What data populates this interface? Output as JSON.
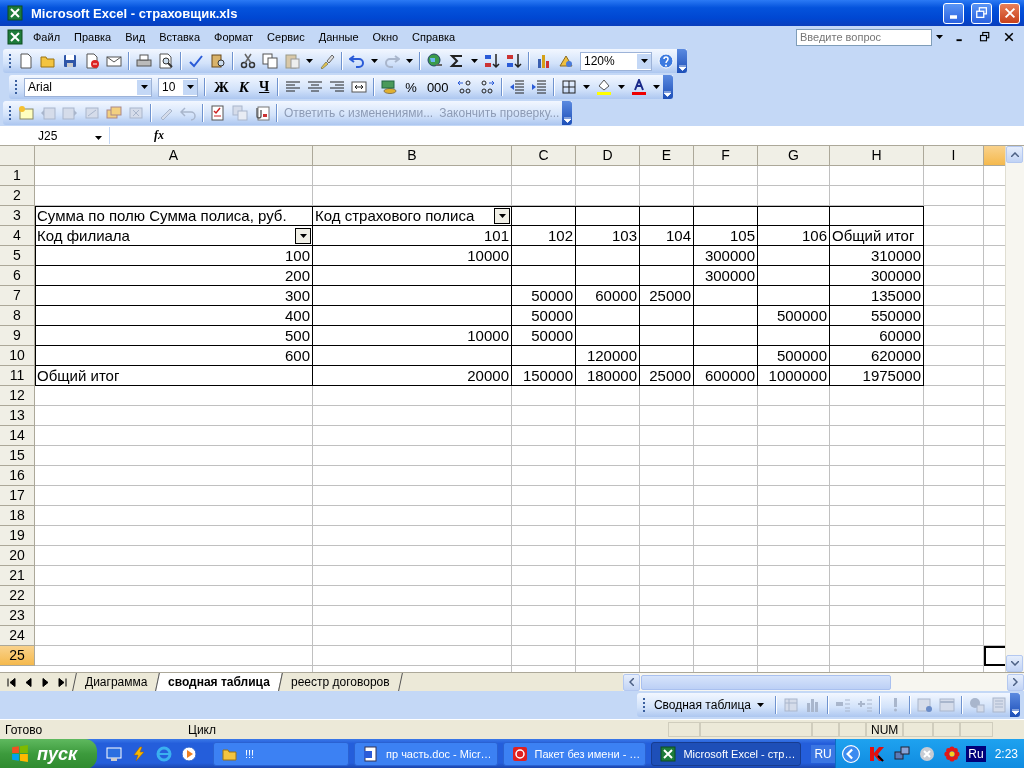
{
  "window": {
    "title": "Microsoft Excel - страховщик.xls"
  },
  "menu_bar": {
    "items": [
      "Файл",
      "Правка",
      "Вид",
      "Вставка",
      "Формат",
      "Сервис",
      "Данные",
      "Окно",
      "Справка"
    ],
    "help_search": {
      "placeholder": "Введите вопрос"
    }
  },
  "standard_toolbar": {
    "zoom": "120%"
  },
  "formatting_toolbar": {
    "font": "Arial",
    "size": "10",
    "bold": "Ж",
    "italic": "К",
    "underline": "Ч",
    "percent": "%",
    "thousands": "000"
  },
  "reviewing_toolbar": {
    "items": [
      {
        "label": "Ответить с изменениями...",
        "disabled": true
      },
      {
        "label": "Закончить проверку...",
        "disabled": true
      }
    ]
  },
  "formula_bar": {
    "name_box": "J25",
    "function_label": "fx"
  },
  "grid": {
    "columns": [
      {
        "label": "A",
        "selected": false
      },
      {
        "label": "B",
        "selected": false
      },
      {
        "label": "C",
        "selected": false
      },
      {
        "label": "D",
        "selected": false
      },
      {
        "label": "E",
        "selected": false
      },
      {
        "label": "F",
        "selected": false
      },
      {
        "label": "G",
        "selected": false
      },
      {
        "label": "H",
        "selected": false
      },
      {
        "label": "I",
        "selected": false
      },
      {
        "selected": true
      }
    ],
    "rows": [
      {
        "number": "1",
        "selected": false,
        "bordered": false
      },
      {
        "number": "2",
        "selected": false,
        "bordered": false
      },
      {
        "number": "3",
        "selected": false,
        "bordered": true,
        "cells": [
          {
            "kind": "text",
            "text": "Сумма по полю Сумма полиса, руб.",
            "dropdown": false
          },
          {
            "kind": "text",
            "text": "Код страхового полиса",
            "dropdown": true
          }
        ]
      },
      {
        "number": "4",
        "selected": false,
        "bordered": true,
        "cells": [
          {
            "kind": "text",
            "text": "Код филиала",
            "dropdown": true
          },
          {
            "kind": "number",
            "text": "101"
          },
          {
            "kind": "number",
            "text": "102"
          },
          {
            "kind": "number",
            "text": "103"
          },
          {
            "kind": "number",
            "text": "104"
          },
          {
            "kind": "number",
            "text": "105"
          },
          {
            "kind": "number",
            "text": "106"
          },
          {
            "kind": "text",
            "text": "Общий итог",
            "dropdown": false
          }
        ]
      },
      {
        "number": "5",
        "selected": false,
        "bordered": true,
        "cells": [
          {
            "kind": "number",
            "text": "100"
          },
          {
            "kind": "number",
            "text": "10000"
          },
          {
            "kind": "blank"
          },
          {
            "kind": "blank"
          },
          {
            "kind": "blank"
          },
          {
            "kind": "number",
            "text": "300000"
          },
          {
            "kind": "blank"
          },
          {
            "kind": "number",
            "text": "310000"
          }
        ]
      },
      {
        "number": "6",
        "selected": false,
        "bordered": true,
        "cells": [
          {
            "kind": "number",
            "text": "200"
          },
          {
            "kind": "blank"
          },
          {
            "kind": "blank"
          },
          {
            "kind": "blank"
          },
          {
            "kind": "blank"
          },
          {
            "kind": "number",
            "text": "300000"
          },
          {
            "kind": "blank"
          },
          {
            "kind": "number",
            "text": "300000"
          }
        ]
      },
      {
        "number": "7",
        "selected": false,
        "bordered": true,
        "cells": [
          {
            "kind": "number",
            "text": "300"
          },
          {
            "kind": "blank"
          },
          {
            "kind": "number",
            "text": "50000"
          },
          {
            "kind": "number",
            "text": "60000"
          },
          {
            "kind": "number",
            "text": "25000"
          },
          {
            "kind": "blank"
          },
          {
            "kind": "blank"
          },
          {
            "kind": "number",
            "text": "135000"
          }
        ]
      },
      {
        "number": "8",
        "selected": false,
        "bordered": true,
        "cells": [
          {
            "kind": "number",
            "text": "400"
          },
          {
            "kind": "blank"
          },
          {
            "kind": "number",
            "text": "50000"
          },
          {
            "kind": "blank"
          },
          {
            "kind": "blank"
          },
          {
            "kind": "blank"
          },
          {
            "kind": "number",
            "text": "500000"
          },
          {
            "kind": "number",
            "text": "550000"
          }
        ]
      },
      {
        "number": "9",
        "selected": false,
        "bordered": true,
        "cells": [
          {
            "kind": "number",
            "text": "500"
          },
          {
            "kind": "number",
            "text": "10000"
          },
          {
            "kind": "number",
            "text": "50000"
          },
          {
            "kind": "blank"
          },
          {
            "kind": "blank"
          },
          {
            "kind": "blank"
          },
          {
            "kind": "blank"
          },
          {
            "kind": "number",
            "text": "60000"
          }
        ]
      },
      {
        "number": "10",
        "selected": false,
        "bordered": true,
        "cells": [
          {
            "kind": "number",
            "text": "600"
          },
          {
            "kind": "blank"
          },
          {
            "kind": "blank"
          },
          {
            "kind": "number",
            "text": "120000"
          },
          {
            "kind": "blank"
          },
          {
            "kind": "blank"
          },
          {
            "kind": "number",
            "text": "500000"
          },
          {
            "kind": "number",
            "text": "620000"
          }
        ]
      },
      {
        "number": "11",
        "selected": false,
        "bordered": true,
        "cells": [
          {
            "kind": "text",
            "text": "Общий итог",
            "dropdown": false
          },
          {
            "kind": "number",
            "text": "20000"
          },
          {
            "kind": "number",
            "text": "150000"
          },
          {
            "kind": "number",
            "text": "180000"
          },
          {
            "kind": "number",
            "text": "25000"
          },
          {
            "kind": "number",
            "text": "600000"
          },
          {
            "kind": "number",
            "text": "1000000"
          },
          {
            "kind": "number",
            "text": "1975000"
          }
        ]
      },
      {
        "number": "12",
        "selected": false,
        "bordered": false
      },
      {
        "number": "13",
        "selected": false,
        "bordered": false
      },
      {
        "number": "14",
        "selected": false,
        "bordered": false
      },
      {
        "number": "15",
        "selected": false,
        "bordered": false
      },
      {
        "number": "16",
        "selected": false,
        "bordered": false
      },
      {
        "number": "17",
        "selected": false,
        "bordered": false
      },
      {
        "number": "18",
        "selected": false,
        "bordered": false
      },
      {
        "number": "19",
        "selected": false,
        "bordered": false
      },
      {
        "number": "20",
        "selected": false,
        "bordered": false
      },
      {
        "number": "21",
        "selected": false,
        "bordered": false
      },
      {
        "number": "22",
        "selected": false,
        "bordered": false
      },
      {
        "number": "23",
        "selected": false,
        "bordered": false
      },
      {
        "number": "24",
        "selected": false,
        "bordered": false
      },
      {
        "number": "25",
        "selected": true,
        "bordered": false
      }
    ]
  },
  "sheet_tabs": [
    {
      "label": "Диаграмма",
      "selected": false
    },
    {
      "label": "сводная таблица",
      "selected": true
    },
    {
      "label": "реестр договоров",
      "selected": false
    }
  ],
  "pivot_toolbar": {
    "menu": "Сводная таблица"
  },
  "status_bar": {
    "status": "Готово",
    "mode": "Цикл",
    "num_lock": "NUM"
  },
  "taskbar": {
    "start": "пуск",
    "tasks": [
      {
        "label": "!!!",
        "kind": "folder",
        "selected": false
      },
      {
        "label": "пр часть.doc - Micr…",
        "kind": "document",
        "selected": false
      },
      {
        "label": "Пакет без имени - …",
        "kind": "app",
        "selected": false
      },
      {
        "label": "Microsoft Excel - стр…",
        "kind": "spreadsheet",
        "selected": true
      }
    ],
    "language": "RU",
    "tray_label": "Ru",
    "clock": "2:23"
  }
}
